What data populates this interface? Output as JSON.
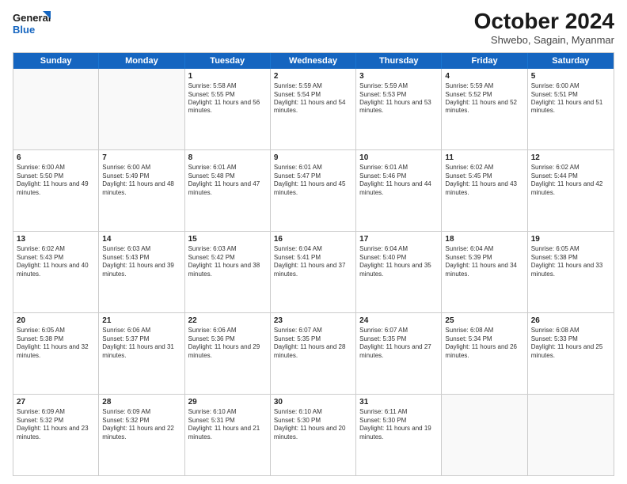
{
  "logo": {
    "line1": "General",
    "line2": "Blue"
  },
  "title": "October 2024",
  "subtitle": "Shwebo, Sagain, Myanmar",
  "weekdays": [
    "Sunday",
    "Monday",
    "Tuesday",
    "Wednesday",
    "Thursday",
    "Friday",
    "Saturday"
  ],
  "rows": [
    [
      {
        "day": "",
        "sunrise": "",
        "sunset": "",
        "daylight": "",
        "empty": true
      },
      {
        "day": "",
        "sunrise": "",
        "sunset": "",
        "daylight": "",
        "empty": true
      },
      {
        "day": "1",
        "sunrise": "Sunrise: 5:58 AM",
        "sunset": "Sunset: 5:55 PM",
        "daylight": "Daylight: 11 hours and 56 minutes."
      },
      {
        "day": "2",
        "sunrise": "Sunrise: 5:59 AM",
        "sunset": "Sunset: 5:54 PM",
        "daylight": "Daylight: 11 hours and 54 minutes."
      },
      {
        "day": "3",
        "sunrise": "Sunrise: 5:59 AM",
        "sunset": "Sunset: 5:53 PM",
        "daylight": "Daylight: 11 hours and 53 minutes."
      },
      {
        "day": "4",
        "sunrise": "Sunrise: 5:59 AM",
        "sunset": "Sunset: 5:52 PM",
        "daylight": "Daylight: 11 hours and 52 minutes."
      },
      {
        "day": "5",
        "sunrise": "Sunrise: 6:00 AM",
        "sunset": "Sunset: 5:51 PM",
        "daylight": "Daylight: 11 hours and 51 minutes."
      }
    ],
    [
      {
        "day": "6",
        "sunrise": "Sunrise: 6:00 AM",
        "sunset": "Sunset: 5:50 PM",
        "daylight": "Daylight: 11 hours and 49 minutes."
      },
      {
        "day": "7",
        "sunrise": "Sunrise: 6:00 AM",
        "sunset": "Sunset: 5:49 PM",
        "daylight": "Daylight: 11 hours and 48 minutes."
      },
      {
        "day": "8",
        "sunrise": "Sunrise: 6:01 AM",
        "sunset": "Sunset: 5:48 PM",
        "daylight": "Daylight: 11 hours and 47 minutes."
      },
      {
        "day": "9",
        "sunrise": "Sunrise: 6:01 AM",
        "sunset": "Sunset: 5:47 PM",
        "daylight": "Daylight: 11 hours and 45 minutes."
      },
      {
        "day": "10",
        "sunrise": "Sunrise: 6:01 AM",
        "sunset": "Sunset: 5:46 PM",
        "daylight": "Daylight: 11 hours and 44 minutes."
      },
      {
        "day": "11",
        "sunrise": "Sunrise: 6:02 AM",
        "sunset": "Sunset: 5:45 PM",
        "daylight": "Daylight: 11 hours and 43 minutes."
      },
      {
        "day": "12",
        "sunrise": "Sunrise: 6:02 AM",
        "sunset": "Sunset: 5:44 PM",
        "daylight": "Daylight: 11 hours and 42 minutes."
      }
    ],
    [
      {
        "day": "13",
        "sunrise": "Sunrise: 6:02 AM",
        "sunset": "Sunset: 5:43 PM",
        "daylight": "Daylight: 11 hours and 40 minutes."
      },
      {
        "day": "14",
        "sunrise": "Sunrise: 6:03 AM",
        "sunset": "Sunset: 5:43 PM",
        "daylight": "Daylight: 11 hours and 39 minutes."
      },
      {
        "day": "15",
        "sunrise": "Sunrise: 6:03 AM",
        "sunset": "Sunset: 5:42 PM",
        "daylight": "Daylight: 11 hours and 38 minutes."
      },
      {
        "day": "16",
        "sunrise": "Sunrise: 6:04 AM",
        "sunset": "Sunset: 5:41 PM",
        "daylight": "Daylight: 11 hours and 37 minutes."
      },
      {
        "day": "17",
        "sunrise": "Sunrise: 6:04 AM",
        "sunset": "Sunset: 5:40 PM",
        "daylight": "Daylight: 11 hours and 35 minutes."
      },
      {
        "day": "18",
        "sunrise": "Sunrise: 6:04 AM",
        "sunset": "Sunset: 5:39 PM",
        "daylight": "Daylight: 11 hours and 34 minutes."
      },
      {
        "day": "19",
        "sunrise": "Sunrise: 6:05 AM",
        "sunset": "Sunset: 5:38 PM",
        "daylight": "Daylight: 11 hours and 33 minutes."
      }
    ],
    [
      {
        "day": "20",
        "sunrise": "Sunrise: 6:05 AM",
        "sunset": "Sunset: 5:38 PM",
        "daylight": "Daylight: 11 hours and 32 minutes."
      },
      {
        "day": "21",
        "sunrise": "Sunrise: 6:06 AM",
        "sunset": "Sunset: 5:37 PM",
        "daylight": "Daylight: 11 hours and 31 minutes."
      },
      {
        "day": "22",
        "sunrise": "Sunrise: 6:06 AM",
        "sunset": "Sunset: 5:36 PM",
        "daylight": "Daylight: 11 hours and 29 minutes."
      },
      {
        "day": "23",
        "sunrise": "Sunrise: 6:07 AM",
        "sunset": "Sunset: 5:35 PM",
        "daylight": "Daylight: 11 hours and 28 minutes."
      },
      {
        "day": "24",
        "sunrise": "Sunrise: 6:07 AM",
        "sunset": "Sunset: 5:35 PM",
        "daylight": "Daylight: 11 hours and 27 minutes."
      },
      {
        "day": "25",
        "sunrise": "Sunrise: 6:08 AM",
        "sunset": "Sunset: 5:34 PM",
        "daylight": "Daylight: 11 hours and 26 minutes."
      },
      {
        "day": "26",
        "sunrise": "Sunrise: 6:08 AM",
        "sunset": "Sunset: 5:33 PM",
        "daylight": "Daylight: 11 hours and 25 minutes."
      }
    ],
    [
      {
        "day": "27",
        "sunrise": "Sunrise: 6:09 AM",
        "sunset": "Sunset: 5:32 PM",
        "daylight": "Daylight: 11 hours and 23 minutes."
      },
      {
        "day": "28",
        "sunrise": "Sunrise: 6:09 AM",
        "sunset": "Sunset: 5:32 PM",
        "daylight": "Daylight: 11 hours and 22 minutes."
      },
      {
        "day": "29",
        "sunrise": "Sunrise: 6:10 AM",
        "sunset": "Sunset: 5:31 PM",
        "daylight": "Daylight: 11 hours and 21 minutes."
      },
      {
        "day": "30",
        "sunrise": "Sunrise: 6:10 AM",
        "sunset": "Sunset: 5:30 PM",
        "daylight": "Daylight: 11 hours and 20 minutes."
      },
      {
        "day": "31",
        "sunrise": "Sunrise: 6:11 AM",
        "sunset": "Sunset: 5:30 PM",
        "daylight": "Daylight: 11 hours and 19 minutes."
      },
      {
        "day": "",
        "sunrise": "",
        "sunset": "",
        "daylight": "",
        "empty": true
      },
      {
        "day": "",
        "sunrise": "",
        "sunset": "",
        "daylight": "",
        "empty": true
      }
    ]
  ]
}
